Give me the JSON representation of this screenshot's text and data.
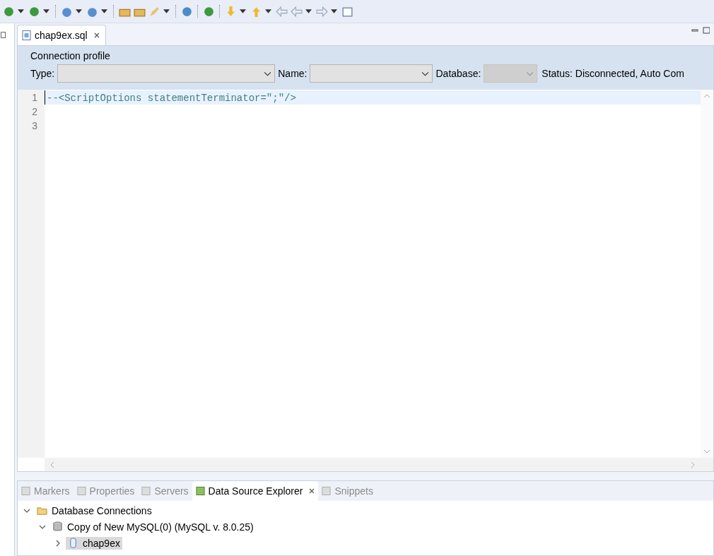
{
  "editor": {
    "tabs": [
      {
        "label": "chap9ex.sql",
        "selected": true,
        "closable": true
      }
    ],
    "connection_profile": {
      "title": "Connection profile",
      "combos": [
        {
          "label": "Type:",
          "kind": "wide",
          "disabled": false
        },
        {
          "label": "Name:",
          "kind": "medium",
          "disabled": false
        },
        {
          "label": "Database:",
          "kind": "narrow",
          "disabled": true
        }
      ],
      "status": "Status: Disconnected, Auto Com"
    },
    "lines": [
      {
        "number": "1",
        "text": "--<ScriptOptions statementTerminator=\";\"/>",
        "current": true
      },
      {
        "number": "2",
        "current": false
      },
      {
        "number": "3",
        "current": false
      }
    ]
  },
  "bottom_panel": {
    "tabs": [
      {
        "label": "Markers",
        "selected": false,
        "closable": false
      },
      {
        "label": "Properties",
        "selected": false,
        "closable": false
      },
      {
        "label": "Servers",
        "selected": false,
        "closable": false
      },
      {
        "label": "Data Source Explorer",
        "selected": true,
        "closable": true
      },
      {
        "label": "Snippets",
        "selected": false,
        "closable": false
      }
    ],
    "tree": [
      {
        "label": "Database Connections",
        "kind": "folder",
        "expanded": true,
        "selected": false,
        "children": [
          {
            "label": "Copy of New MySQL(0) (MySQL v. 8.0.25)",
            "kind": "connection",
            "expanded": true,
            "selected": false,
            "children": [
              {
                "label": "chap9ex",
                "kind": "database",
                "expanded": false,
                "selected": true
              }
            ]
          }
        ]
      }
    ]
  }
}
